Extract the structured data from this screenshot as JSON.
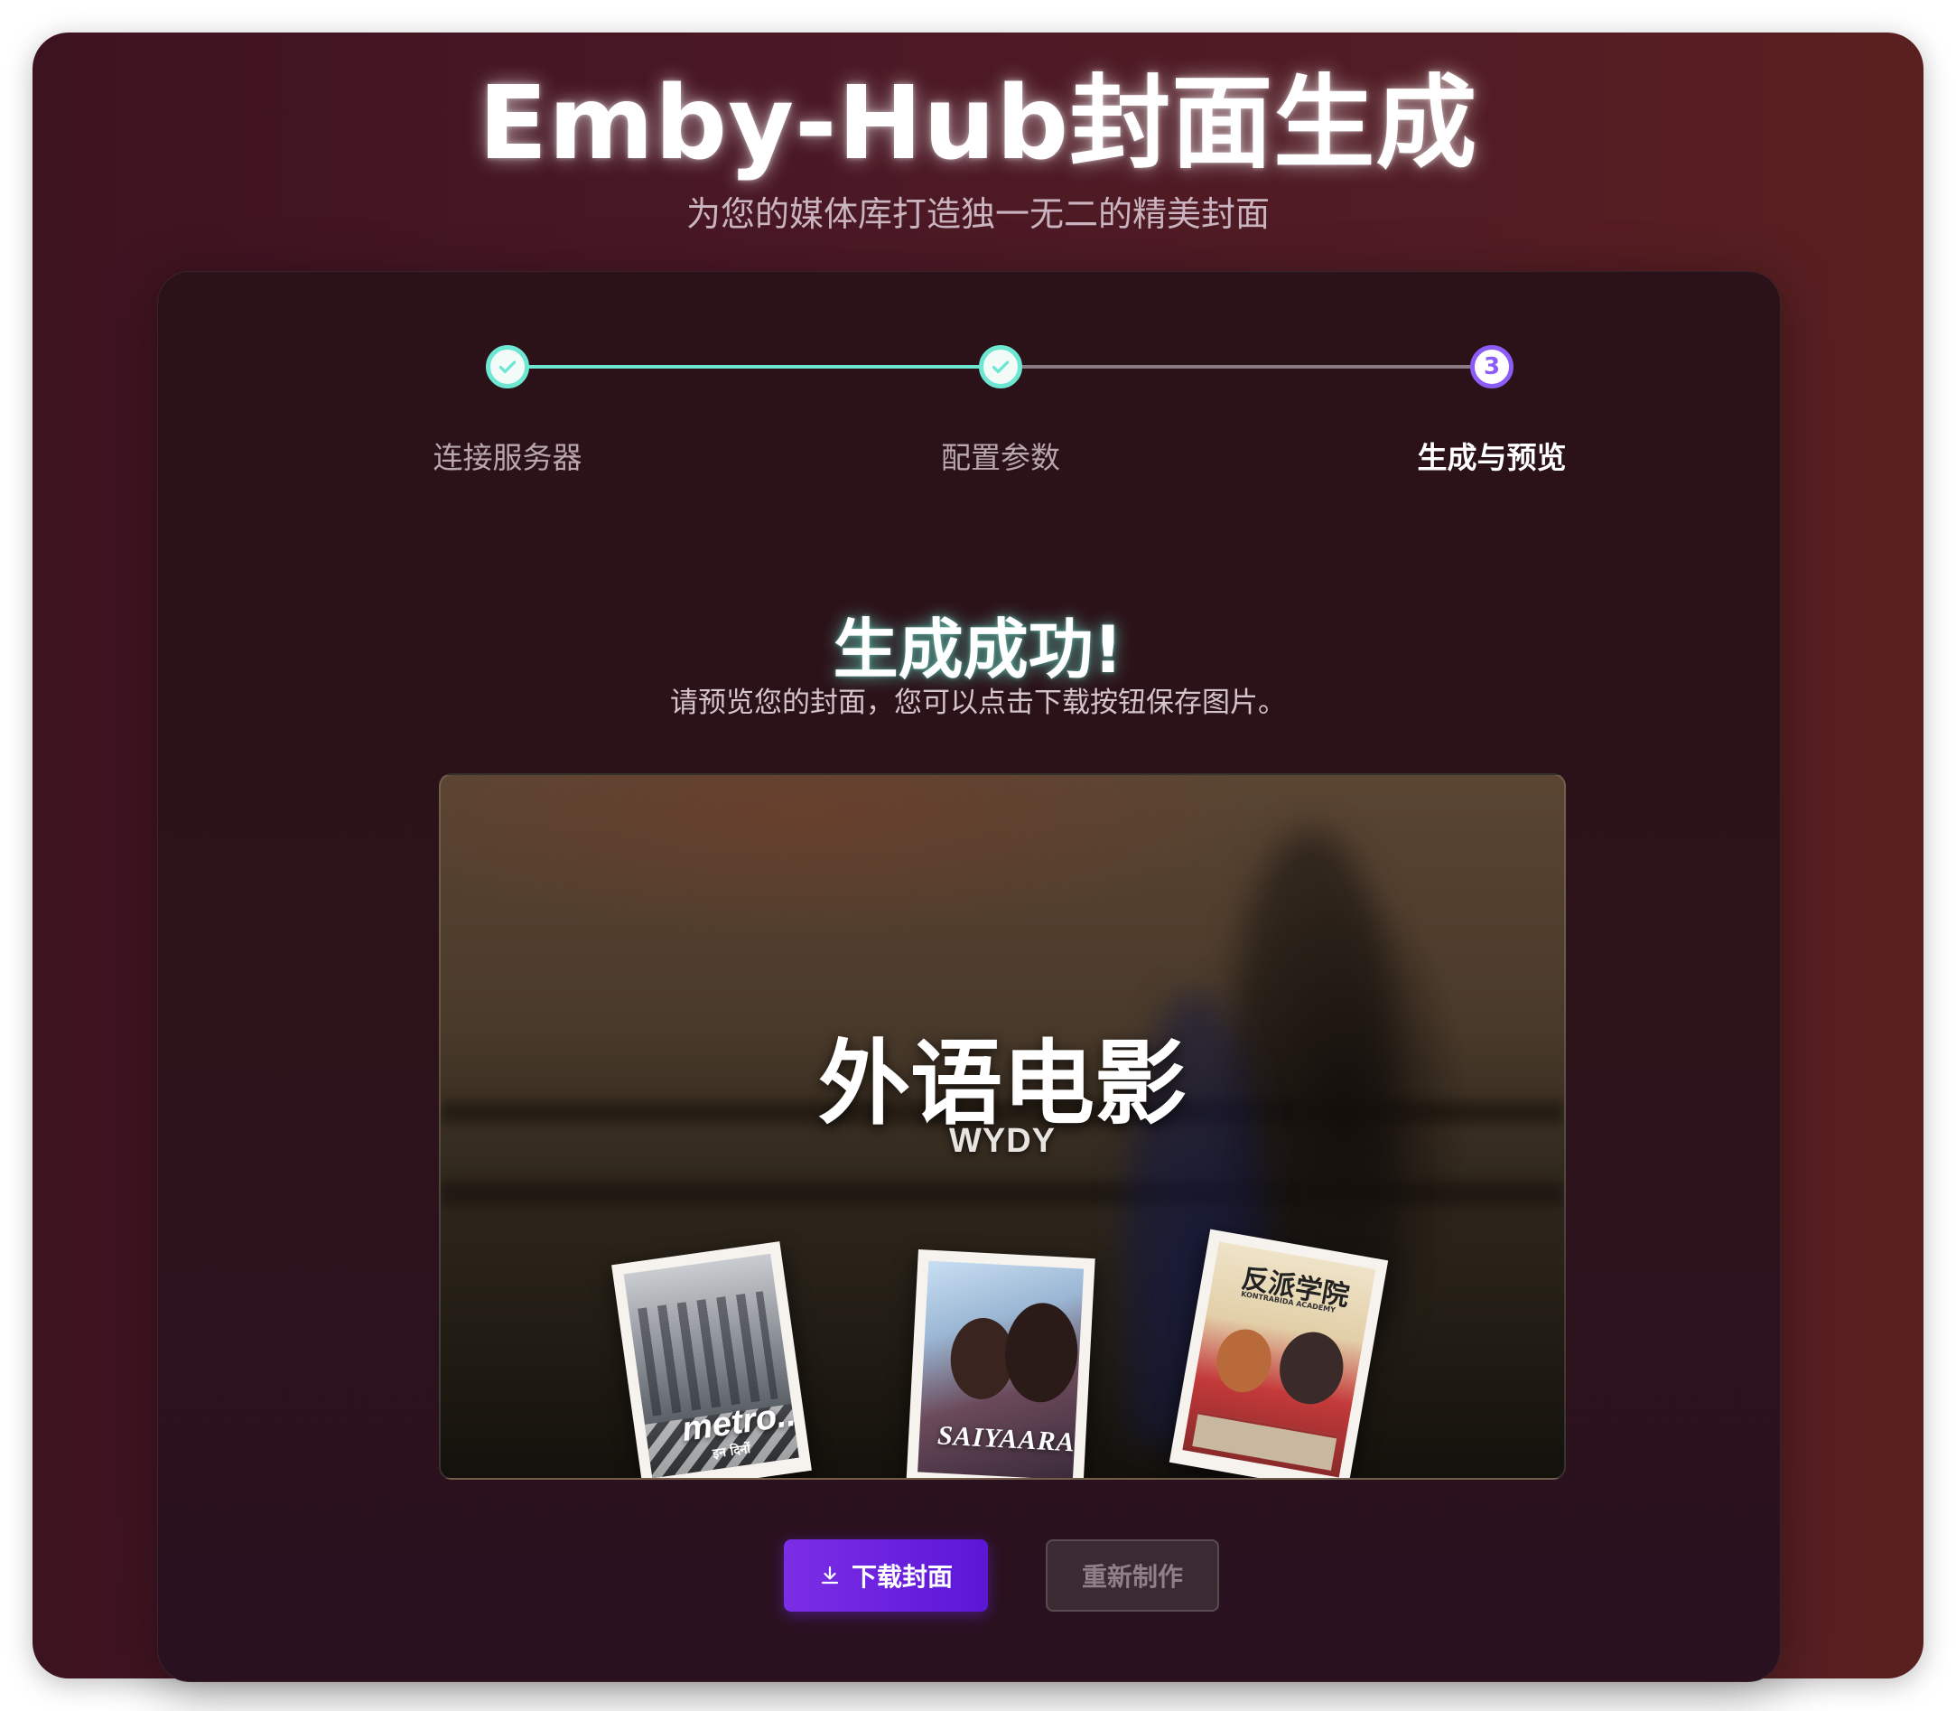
{
  "header": {
    "title": "Emby-Hub封面生成",
    "subtitle": "为您的媒体库打造独一无二的精美封面"
  },
  "stepper": {
    "steps": [
      {
        "label": "连接服务器",
        "state": "done"
      },
      {
        "label": "配置参数",
        "state": "done"
      },
      {
        "label": "生成与预览",
        "number": "3",
        "state": "active"
      }
    ],
    "done_color": "#6ee7d2",
    "active_color": "#8b5cf6"
  },
  "result": {
    "title": "生成成功!",
    "description": "请预览您的封面，您可以点击下载按钮保存图片。"
  },
  "cover": {
    "title": "外语电影",
    "subtitle": "WYDY",
    "posters": [
      {
        "title": "metro...",
        "subtitle": "इन दिनों"
      },
      {
        "title": "SAIYAARA"
      },
      {
        "title": "反派学院",
        "subtitle": "KONTRABIDA ACADEMY"
      }
    ]
  },
  "actions": {
    "download_label": "下载封面",
    "redo_label": "重新制作"
  }
}
